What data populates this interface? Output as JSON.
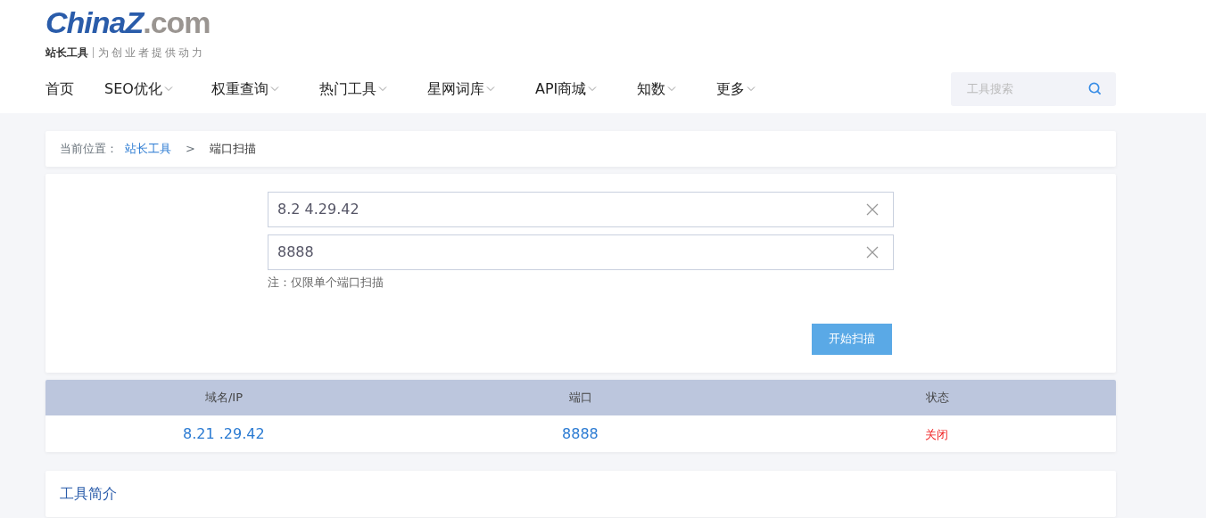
{
  "logo": {
    "brand_main": "China",
    "brand_mark": "Z",
    "brand_suffix": ".com",
    "tagline_bold": "站长工具",
    "tagline": "为创业者提供动力"
  },
  "nav": [
    {
      "label": "首页",
      "has_menu": false
    },
    {
      "label": "SEO优化",
      "has_menu": true
    },
    {
      "label": "权重查询",
      "has_menu": true
    },
    {
      "label": "热门工具",
      "has_menu": true
    },
    {
      "label": "星网词库",
      "has_menu": true
    },
    {
      "label": "API商城",
      "has_menu": true
    },
    {
      "label": "知数",
      "has_menu": true
    },
    {
      "label": "更多",
      "has_menu": true
    }
  ],
  "search": {
    "placeholder": "工具搜索"
  },
  "breadcrumb": {
    "prefix": "当前位置：",
    "items": [
      "站长工具",
      "端口扫描"
    ],
    "separator": ">"
  },
  "form": {
    "host": {
      "value": "8.2 4.29.42"
    },
    "port": {
      "value": "8888"
    },
    "note": "注：仅限单个端口扫描",
    "button": "开始扫描"
  },
  "table": {
    "columns": [
      "域名/IP",
      "端口",
      "状态"
    ],
    "rows": [
      {
        "host": "8.21 .29.42",
        "port": "8888",
        "status": "关闭",
        "open": false
      }
    ]
  },
  "intro": {
    "title": "工具简介"
  }
}
